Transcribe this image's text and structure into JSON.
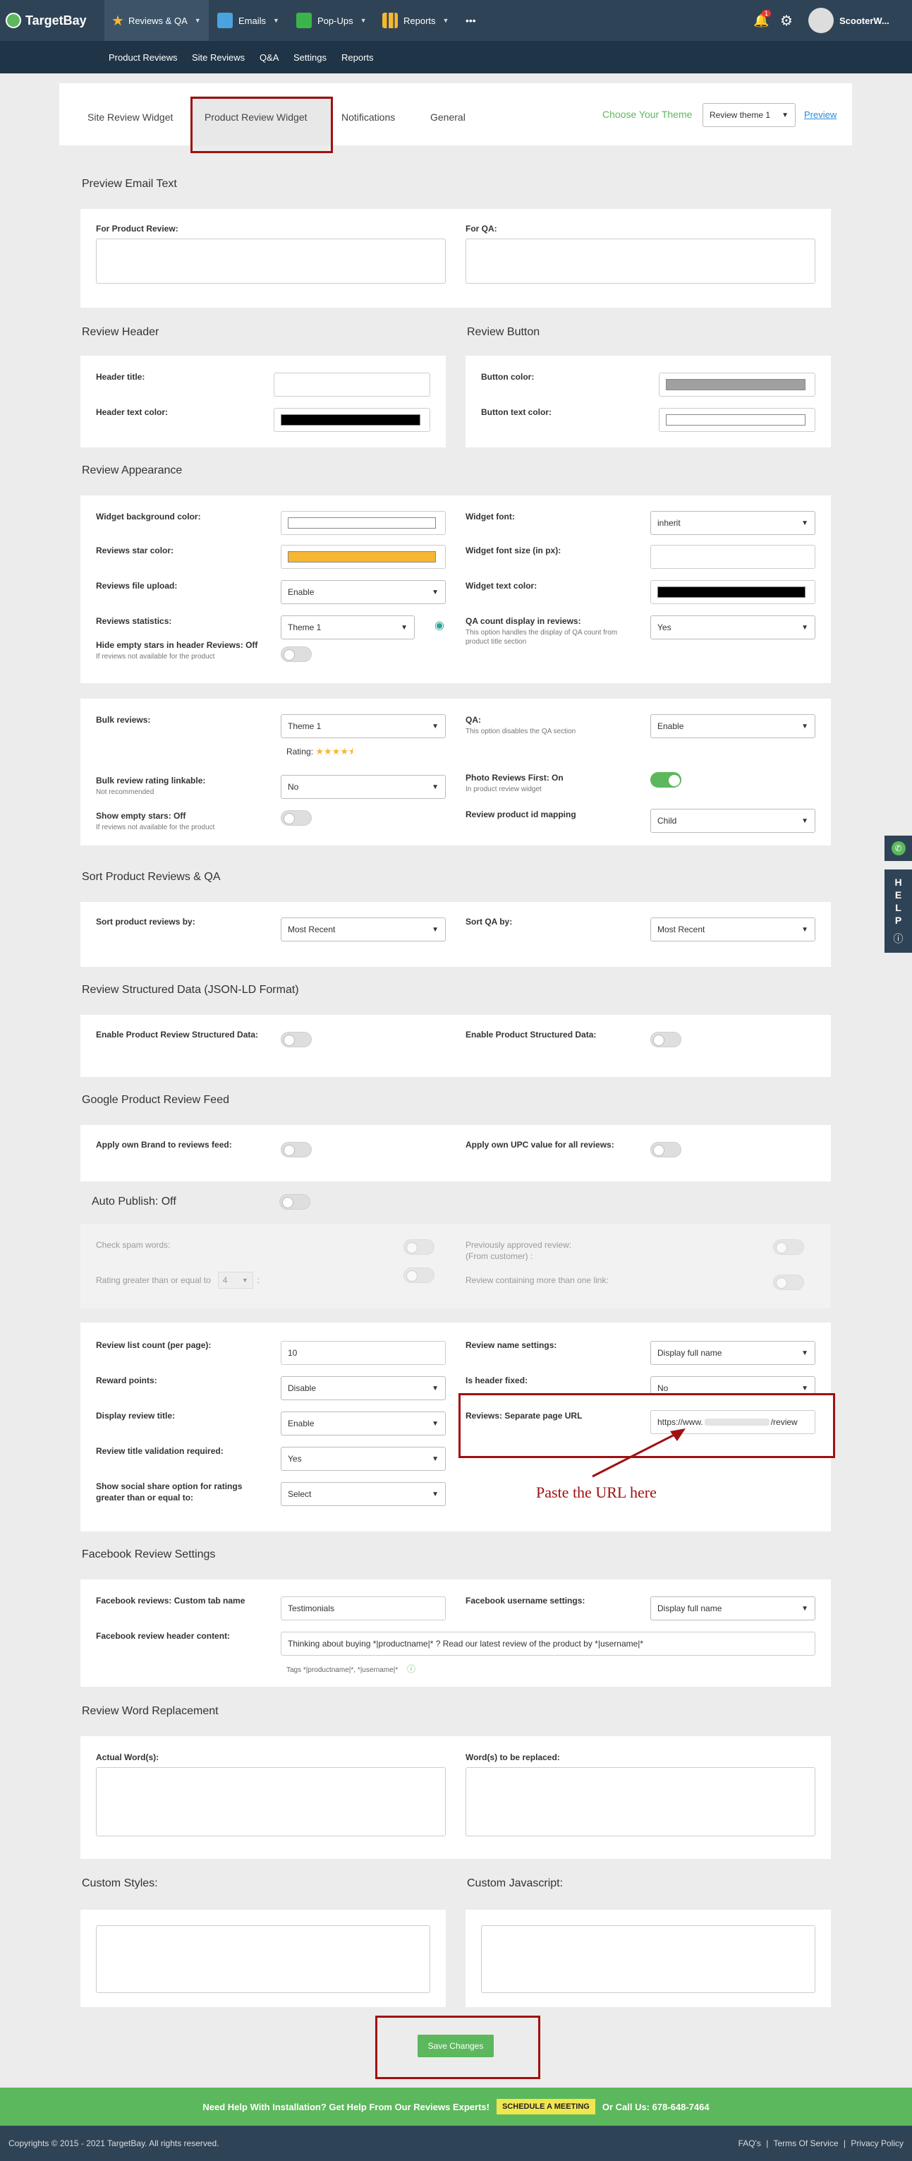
{
  "nav": {
    "logo": "TargetBay",
    "items": [
      "Reviews & QA",
      "Emails",
      "Pop-Ups",
      "Reports"
    ],
    "more": "•••",
    "notif_count": "1",
    "user": "ScooterW..."
  },
  "subnav": [
    "Product Reviews",
    "Site Reviews",
    "Q&A",
    "Settings",
    "Reports"
  ],
  "tabs": [
    "Site Review Widget",
    "Product Review Widget",
    "Notifications",
    "General"
  ],
  "theme": {
    "label": "Choose Your Theme",
    "value": "Review theme 1",
    "preview": "Preview"
  },
  "preview_email": {
    "title": "Preview Email Text",
    "product_label": "For Product Review:",
    "qa_label": "For QA:"
  },
  "review_header": {
    "title": "Review Header",
    "header_title": "Header title:",
    "header_text_color": "Header text color:"
  },
  "review_button": {
    "title": "Review Button",
    "button_color": "Button color:",
    "button_text_color": "Button text color:"
  },
  "appearance": {
    "title": "Review Appearance",
    "widget_bg": "Widget background color:",
    "star_color": "Reviews star color:",
    "file_upload": "Reviews file upload:",
    "file_upload_val": "Enable",
    "statistics": "Reviews statistics:",
    "statistics_val": "Theme 1",
    "hide_empty": "Hide empty stars in header Reviews: Off",
    "hide_empty_sub": "If reviews not available for the product",
    "widget_font": "Widget font:",
    "widget_font_val": "inherit",
    "font_size": "Widget font size (in px):",
    "text_color": "Widget text color:",
    "qa_count": "QA count display in reviews:",
    "qa_count_val": "Yes",
    "qa_count_sub": "This option handles the display of QA count from product title section"
  },
  "bulk": {
    "bulk_label": "Bulk reviews:",
    "bulk_val": "Theme 1",
    "rating": "Rating:",
    "stars": "★★★★⯨",
    "linkable": "Bulk review rating linkable:",
    "linkable_sub": "Not recommended",
    "linkable_val": "No",
    "empty_stars": "Show empty stars: Off",
    "empty_stars_sub": "If reviews not available for the product",
    "qa": "QA:",
    "qa_sub": "This option disables the QA section",
    "qa_val": "Enable",
    "photo": "Photo Reviews First: On",
    "photo_sub": "In product review widget",
    "mapping": "Review product id mapping",
    "mapping_val": "Child"
  },
  "sort": {
    "title": "Sort Product Reviews & QA",
    "reviews_by": "Sort product reviews by:",
    "reviews_val": "Most Recent",
    "qa_by": "Sort QA by:",
    "qa_val": "Most Recent"
  },
  "structured": {
    "title": "Review Structured Data (JSON-LD Format)",
    "product_review": "Enable Product Review Structured Data:",
    "product": "Enable Product Structured Data:"
  },
  "google": {
    "title": "Google Product Review Feed",
    "brand": "Apply own Brand to reviews feed:",
    "upc": "Apply own UPC value for all reviews:"
  },
  "auto": {
    "title": "Auto Publish: Off",
    "spam": "Check spam words:",
    "rating_ge": "Rating greater than or equal to",
    "rating_val": "4",
    "colon": ":",
    "approved": "Previously approved review:",
    "approved2": "(From customer) :",
    "links": "Review containing more than one link:"
  },
  "list": {
    "count": "Review list count (per page):",
    "count_val": "10",
    "reward": "Reward points:",
    "reward_val": "Disable",
    "display_title": "Display review title:",
    "display_title_val": "Enable",
    "validation": "Review title validation required:",
    "validation_val": "Yes",
    "social": "Show social share option for ratings greater than or equal to:",
    "social_val": "Select",
    "name": "Review name settings:",
    "name_val": "Display full name",
    "fixed": "Is header fixed:",
    "fixed_val": "No",
    "url": "Reviews: Separate page URL",
    "url_val": "https://www.",
    "url_tail": "/review",
    "annotation": "Paste the URL here"
  },
  "facebook": {
    "title": "Facebook Review Settings",
    "tab_name": "Facebook reviews: Custom tab name",
    "tab_val": "Testimonials",
    "username": "Facebook username settings:",
    "username_val": "Display full name",
    "header": "Facebook review header content:",
    "header_val": "Thinking about buying *|productname|* ? Read our latest review of the product by *|username|*",
    "tags": "Tags *|productname|*, *|username|*"
  },
  "word": {
    "title": "Review Word Replacement",
    "actual": "Actual Word(s):",
    "replaced": "Word(s) to be replaced:"
  },
  "custom": {
    "styles": "Custom Styles:",
    "js": "Custom Javascript:"
  },
  "save": "Save Changes",
  "banner": {
    "text": "Need Help With Installation? Get Help From Our Reviews Experts!",
    "meeting": "SCHEDULE A MEETING",
    "call": "Or Call Us: 678-648-7464"
  },
  "footer": {
    "copyright": "Copyrights © 2015 - 2021 TargetBay. All rights reserved.",
    "faq": "FAQ's",
    "sep": "|",
    "terms": "Terms Of Service",
    "privacy": "Privacy Policy"
  },
  "help": "HELP",
  "colors": {
    "nav": "#2f4356",
    "green": "#5cb85c",
    "annotation": "#a01010",
    "star": "#f5b731"
  }
}
